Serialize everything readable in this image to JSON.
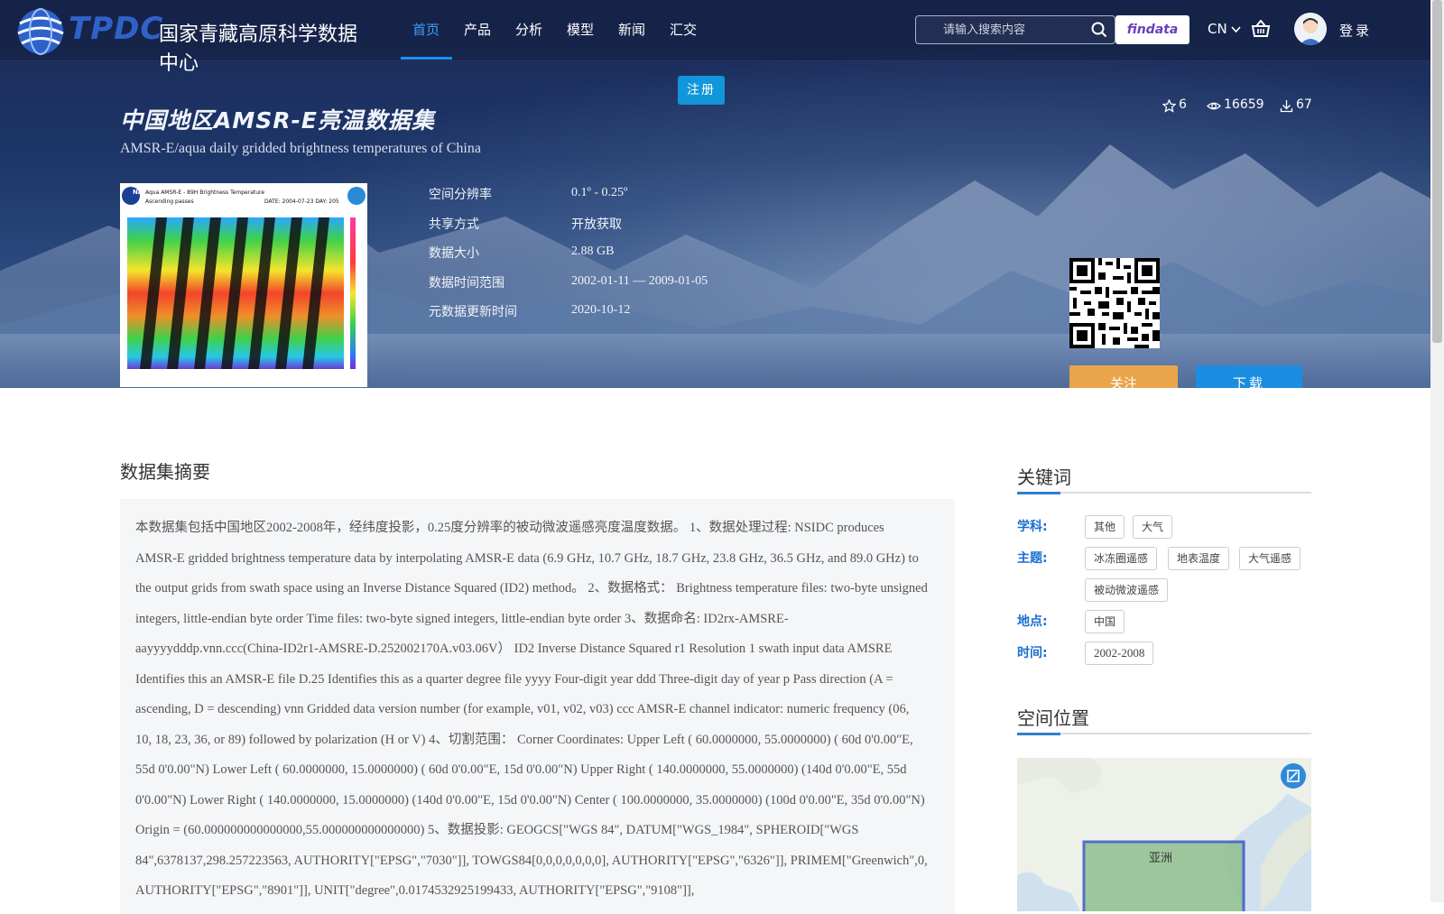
{
  "brand": {
    "short": "TPDC",
    "name": "国家青藏高原科学数据中心"
  },
  "nav": {
    "items": [
      {
        "label": "首页",
        "active": true
      },
      {
        "label": "产品"
      },
      {
        "label": "分析"
      },
      {
        "label": "模型"
      },
      {
        "label": "新闻"
      },
      {
        "label": "汇交"
      }
    ]
  },
  "search": {
    "placeholder": "请输入搜索内容",
    "value": ""
  },
  "header_tools": {
    "findata_label": "findata",
    "lang_label": "CN",
    "login_label": "登录"
  },
  "register_label": "注册",
  "dataset": {
    "title_cn": "中国地区AMSR-E亮温数据集",
    "title_en": "AMSR-E/aqua daily gridded brightness temperatures of China",
    "stats": {
      "favorites": "6",
      "views": "16659",
      "downloads": "67"
    },
    "thumbnail": {
      "caption_line1": "Aqua AMSR-E - 89H Brightness Temperature",
      "caption_line2": "Ascending passes",
      "date_label": "DATE: 2004-07-23  DAY: 205"
    },
    "meta": [
      {
        "label": "空间分辨率",
        "value": "0.1º - 0.25º"
      },
      {
        "label": "共享方式",
        "value": "开放获取"
      },
      {
        "label": "数据大小",
        "value": "2.88 GB"
      },
      {
        "label": "数据时间范围",
        "value": "2002-01-11 — 2009-01-05"
      },
      {
        "label": "元数据更新时间",
        "value": "2020-10-12"
      }
    ],
    "follow_label": "关注",
    "download_label": "下载"
  },
  "abstract": {
    "title": "数据集摘要",
    "text": "本数据集包括中国地区2002-2008年，经纬度投影，0.25度分辨率的被动微波遥感亮度温度数据。 1、数据处理过程: NSIDC produces AMSR-E gridded brightness temperature data by interpolating AMSR-E data (6.9 GHz, 10.7 GHz, 18.7 GHz, 23.8 GHz, 36.5 GHz, and 89.0 GHz) to the output grids from swath space using an Inverse Distance Squared (ID2) method。 2、数据格式： Brightness temperature files: two-byte unsigned integers, little-endian byte order Time files: two-byte signed integers, little-endian byte order 3、数据命名: ID2rx-AMSRE-aayyyydddp.vnn.ccc(China-ID2r1-AMSRE-D.252002170A.v03.06V） ID2 Inverse Distance Squared r1 Resolution 1 swath input data AMSRE Identifies this an AMSR-E file D.25 Identifies this as a quarter degree file yyyy Four-digit year ddd Three-digit day of year p Pass direction (A = ascending, D = descending) vnn Gridded data version number (for example, v01, v02, v03) ccc AMSR-E channel indicator: numeric frequency (06, 10, 18, 23, 36, or 89) followed by polarization (H or V) 4、切割范围： Corner Coordinates: Upper Left ( 60.0000000, 55.0000000) ( 60d 0'0.00\"E, 55d 0'0.00\"N) Lower Left ( 60.0000000, 15.0000000) ( 60d 0'0.00\"E, 15d 0'0.00\"N) Upper Right ( 140.0000000, 55.0000000) (140d 0'0.00\"E, 55d 0'0.00\"N) Lower Right ( 140.0000000, 15.0000000) (140d 0'0.00\"E, 15d 0'0.00\"N) Center ( 100.0000000, 35.0000000) (100d 0'0.00\"E, 35d 0'0.00\"N) Origin = (60.000000000000000,55.000000000000000) 5、数据投影: GEOGCS[\"WGS 84\", DATUM[\"WGS_1984\", SPHEROID[\"WGS 84\",6378137,298.257223563, AUTHORITY[\"EPSG\",\"7030\"]], TOWGS84[0,0,0,0,0,0,0], AUTHORITY[\"EPSG\",\"6326\"]], PRIMEM[\"Greenwich\",0, AUTHORITY[\"EPSG\",\"8901\"]], UNIT[\"degree\",0.0174532925199433, AUTHORITY[\"EPSG\",\"9108\"]],"
  },
  "keywords": {
    "title": "关键词",
    "groups": [
      {
        "label": "学科:",
        "tags": [
          "其他",
          "大气"
        ]
      },
      {
        "label": "主题:",
        "tags": [
          "冰冻圈遥感",
          "地表温度",
          "大气遥感",
          "被动微波遥感"
        ]
      },
      {
        "label": "地点:",
        "tags": [
          "中国"
        ]
      },
      {
        "label": "时间:",
        "tags": [
          "2002-2008"
        ]
      }
    ]
  },
  "location": {
    "title": "空间位置",
    "region_label": "亚洲"
  },
  "colors": {
    "nav_active": "#3aa0ff",
    "register_bg": "#1296db",
    "follow_bg": "#eaa54b",
    "download_bg": "#1b8de0",
    "keyword_label": "#1a6fd0"
  }
}
